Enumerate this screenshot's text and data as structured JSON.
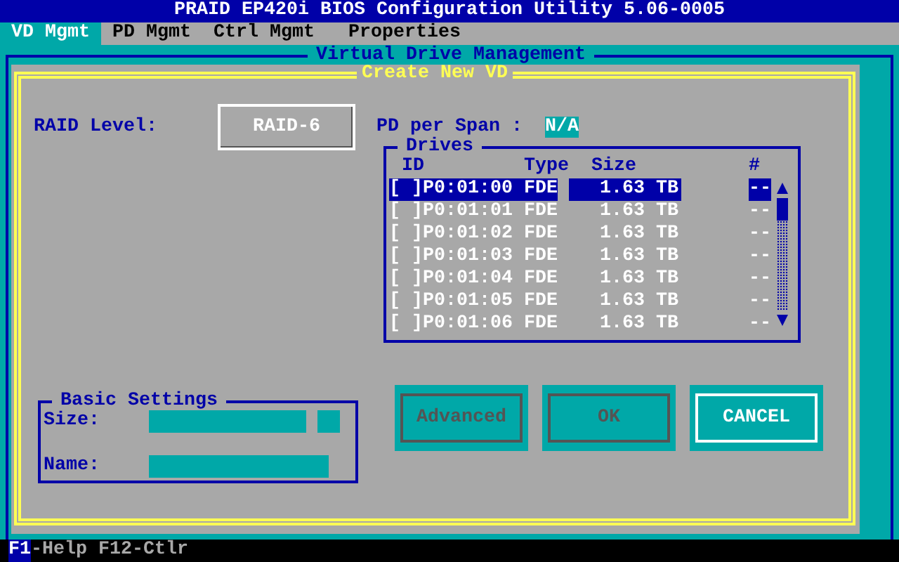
{
  "title": "PRAID EP420i BIOS Configuration Utility 5.06-0005",
  "tabs": [
    {
      "label": "VD Mgmt",
      "selected": true
    },
    {
      "label": "PD Mgmt",
      "selected": false
    },
    {
      "label": "Ctrl Mgmt",
      "selected": false
    },
    {
      "label": "Properties",
      "selected": false
    }
  ],
  "frame_title": "Virtual Drive Management",
  "dialog": {
    "title": "Create New VD",
    "raid_level": {
      "label": "RAID Level:",
      "value": "RAID-6"
    },
    "pd_per_span": {
      "label": "PD per Span :",
      "value": "N/A"
    },
    "drives": {
      "title": "Drives",
      "columns": [
        "ID",
        "Type",
        "Size",
        "#"
      ],
      "rows": [
        {
          "id": "[ ]P0:01:00",
          "type": "FDE",
          "size": "1.63 TB",
          "number": "--",
          "selected": true
        },
        {
          "id": "[ ]P0:01:01",
          "type": "FDE",
          "size": "1.63 TB",
          "number": "--",
          "selected": false
        },
        {
          "id": "[ ]P0:01:02",
          "type": "FDE",
          "size": "1.63 TB",
          "number": "--",
          "selected": false
        },
        {
          "id": "[ ]P0:01:03",
          "type": "FDE",
          "size": "1.63 TB",
          "number": "--",
          "selected": false
        },
        {
          "id": "[ ]P0:01:04",
          "type": "FDE",
          "size": "1.63 TB",
          "number": "--",
          "selected": false
        },
        {
          "id": "[ ]P0:01:05",
          "type": "FDE",
          "size": "1.63 TB",
          "number": "--",
          "selected": false
        },
        {
          "id": "[ ]P0:01:06",
          "type": "FDE",
          "size": "1.63 TB",
          "number": "--",
          "selected": false
        }
      ]
    },
    "basic_settings": {
      "title": "Basic Settings",
      "fields": [
        {
          "label": "Size:",
          "kind": "size"
        },
        {
          "label": "Name:",
          "kind": "name"
        }
      ]
    },
    "buttons": [
      {
        "label": "Advanced",
        "disabled": true
      },
      {
        "label": "OK",
        "disabled": true
      },
      {
        "label": "CANCEL",
        "disabled": false
      }
    ]
  },
  "status_bar": [
    {
      "text": "F1",
      "highlighted": true
    },
    {
      "text": "-Help F12-Ctlr",
      "highlighted": false
    }
  ]
}
